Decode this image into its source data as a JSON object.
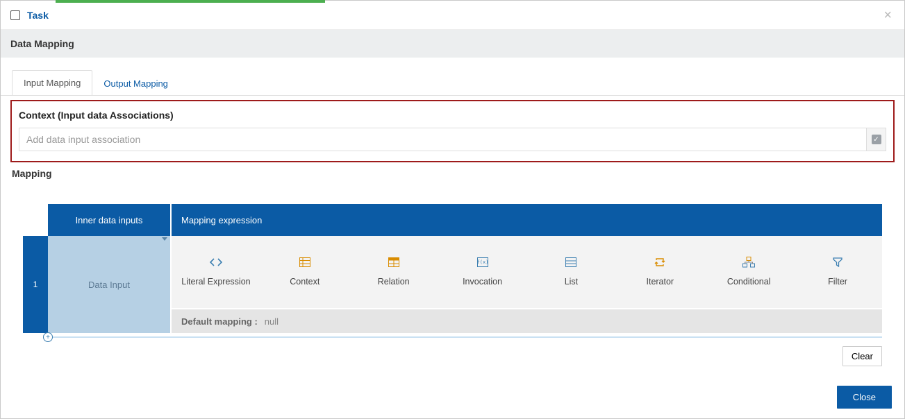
{
  "title": "Task",
  "section": "Data Mapping",
  "tabs": {
    "input": "Input Mapping",
    "output": "Output Mapping"
  },
  "context": {
    "label": "Context (Input data Associations)",
    "placeholder": "Add data input association"
  },
  "mapping_label": "Mapping",
  "inner_header": "Inner data inputs",
  "expr_header": "Mapping expression",
  "row_number": "1",
  "data_input_label": "Data Input",
  "expressions": {
    "literal": "Literal Expression",
    "context": "Context",
    "relation": "Relation",
    "invocation": "Invocation",
    "list": "List",
    "iterator": "Iterator",
    "conditional": "Conditional",
    "filter": "Filter"
  },
  "default_key": "Default mapping :",
  "default_value": "null",
  "clear": "Clear",
  "close": "Close"
}
